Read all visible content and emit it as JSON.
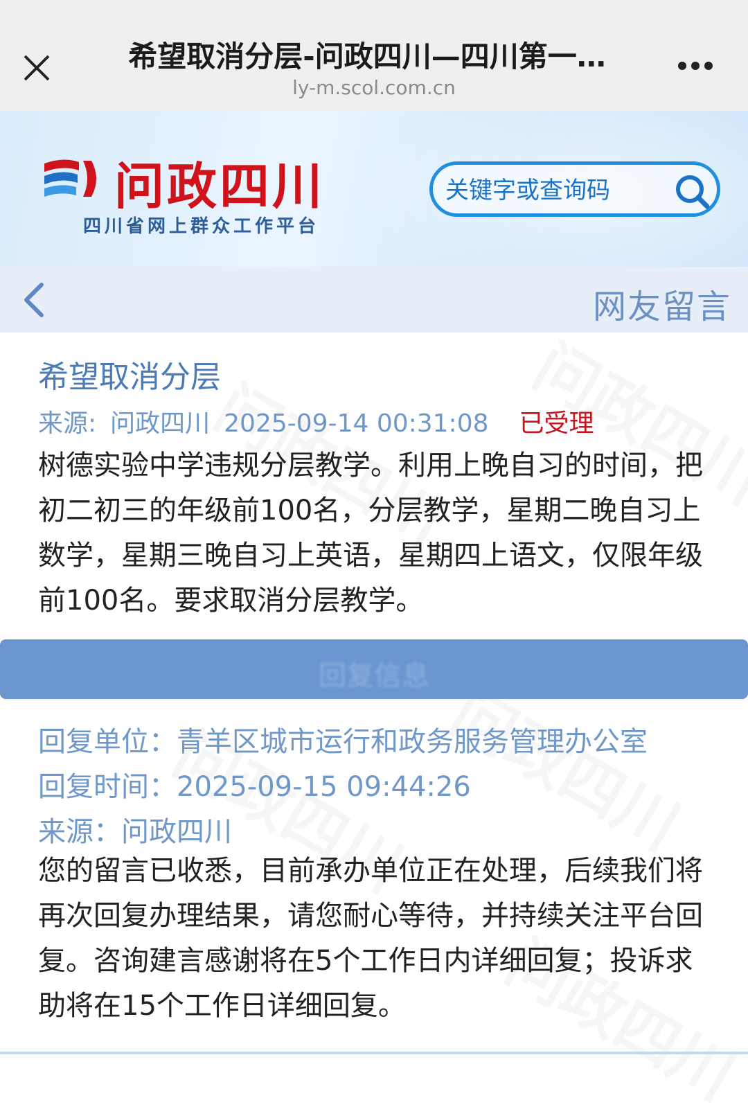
{
  "browser": {
    "title": "希望取消分层-问政四川—四川第一…",
    "url": "ly-m.scol.com.cn"
  },
  "header": {
    "logo_title": "问政四川",
    "logo_subtitle": "四川省网上群众工作平台",
    "search_placeholder": "关键字或查询码"
  },
  "subnav": {
    "title": "网友留言"
  },
  "message": {
    "title": "希望取消分层",
    "source_label": "来源:",
    "source": "问政四川",
    "datetime": "2025-09-14 00:31:08",
    "status": "已受理",
    "body": "树德实验中学违规分层教学。利用上晚自习的时间，把初二初三的年级前100名，分层教学，星期二晚自习上数学，星期三晚自习上英语，星期四上语文，仅限年级前100名。要求取消分层教学。"
  },
  "reply": {
    "bar_label": "回复信息",
    "unit": "回复单位：青羊区城市运行和政务服务管理办公室",
    "time": "回复时间：2025-09-15 09:44:26",
    "source": "来源：问政四川",
    "body": "您的留言已收悉，目前承办单位正在处理，后续我们将再次回复办理结果，请您耐心等待，并持续关注平台回复。咨询建言感谢将在5个工作日内详细回复；投诉求助将在15个工作日详细回复。"
  },
  "colors": {
    "brand_red": "#d0121b",
    "accent_blue": "#1f8fe0",
    "meta_blue": "#6f98c9",
    "status_red": "#c8141e"
  },
  "icons": [
    "close-icon",
    "more-icon",
    "search-icon",
    "back-icon",
    "logo-mark-icon"
  ]
}
